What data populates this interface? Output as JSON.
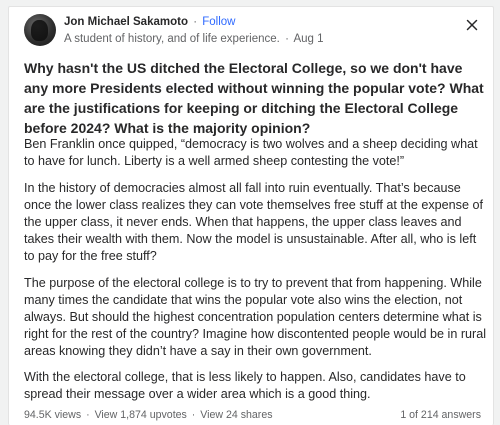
{
  "author": {
    "name": "Jon Michael Sakamoto",
    "follow_label": "Follow",
    "credential": "A student of history, and of life experience.",
    "date": "Aug 1",
    "separator": "·"
  },
  "question": "Why hasn't the US ditched the Electoral College, so we don't have any more Presidents elected without winning the popular vote? What are the justifications for keeping or ditching the Electoral College before 2024? What is the majority opinion?",
  "answer": {
    "paragraphs": [
      "Ben Franklin once quipped, “democracy is two wolves and a sheep deciding what to have for lunch. Liberty is a well armed sheep contesting the vote!”",
      "In the history of democracies almost all fall into ruin eventually. That’s because once the lower class realizes they can vote themselves free stuff at the expense of the upper class, it never ends. When that happens, the upper class leaves and takes their wealth with them. Now the model is unsustainable. After all, who is left to pay for the free stuff?",
      "The purpose of the electoral college is to try to prevent that from happening. While many times the candidate that wins the popular vote also wins the election, not always. But should the highest concentration population centers determine what is right for the rest of the country? Imagine how discontented people would be in rural areas knowing they didn’t have a say in their own government.",
      "With the electoral college, that is less likely to happen. Also, candidates have to spread their message over a wider area which is a good thing."
    ]
  },
  "stats": {
    "views": "94.5K views",
    "upvotes": "View 1,874 upvotes",
    "shares": "View 24 shares",
    "separator": "·",
    "answer_position": "1 of 214 answers"
  },
  "icons": {
    "close": "close-icon",
    "avatar": "avatar"
  },
  "colors": {
    "text": "#282829",
    "muted": "#636466",
    "link": "#2e69ff",
    "background": "#f1f2f2",
    "card": "#ffffff"
  }
}
